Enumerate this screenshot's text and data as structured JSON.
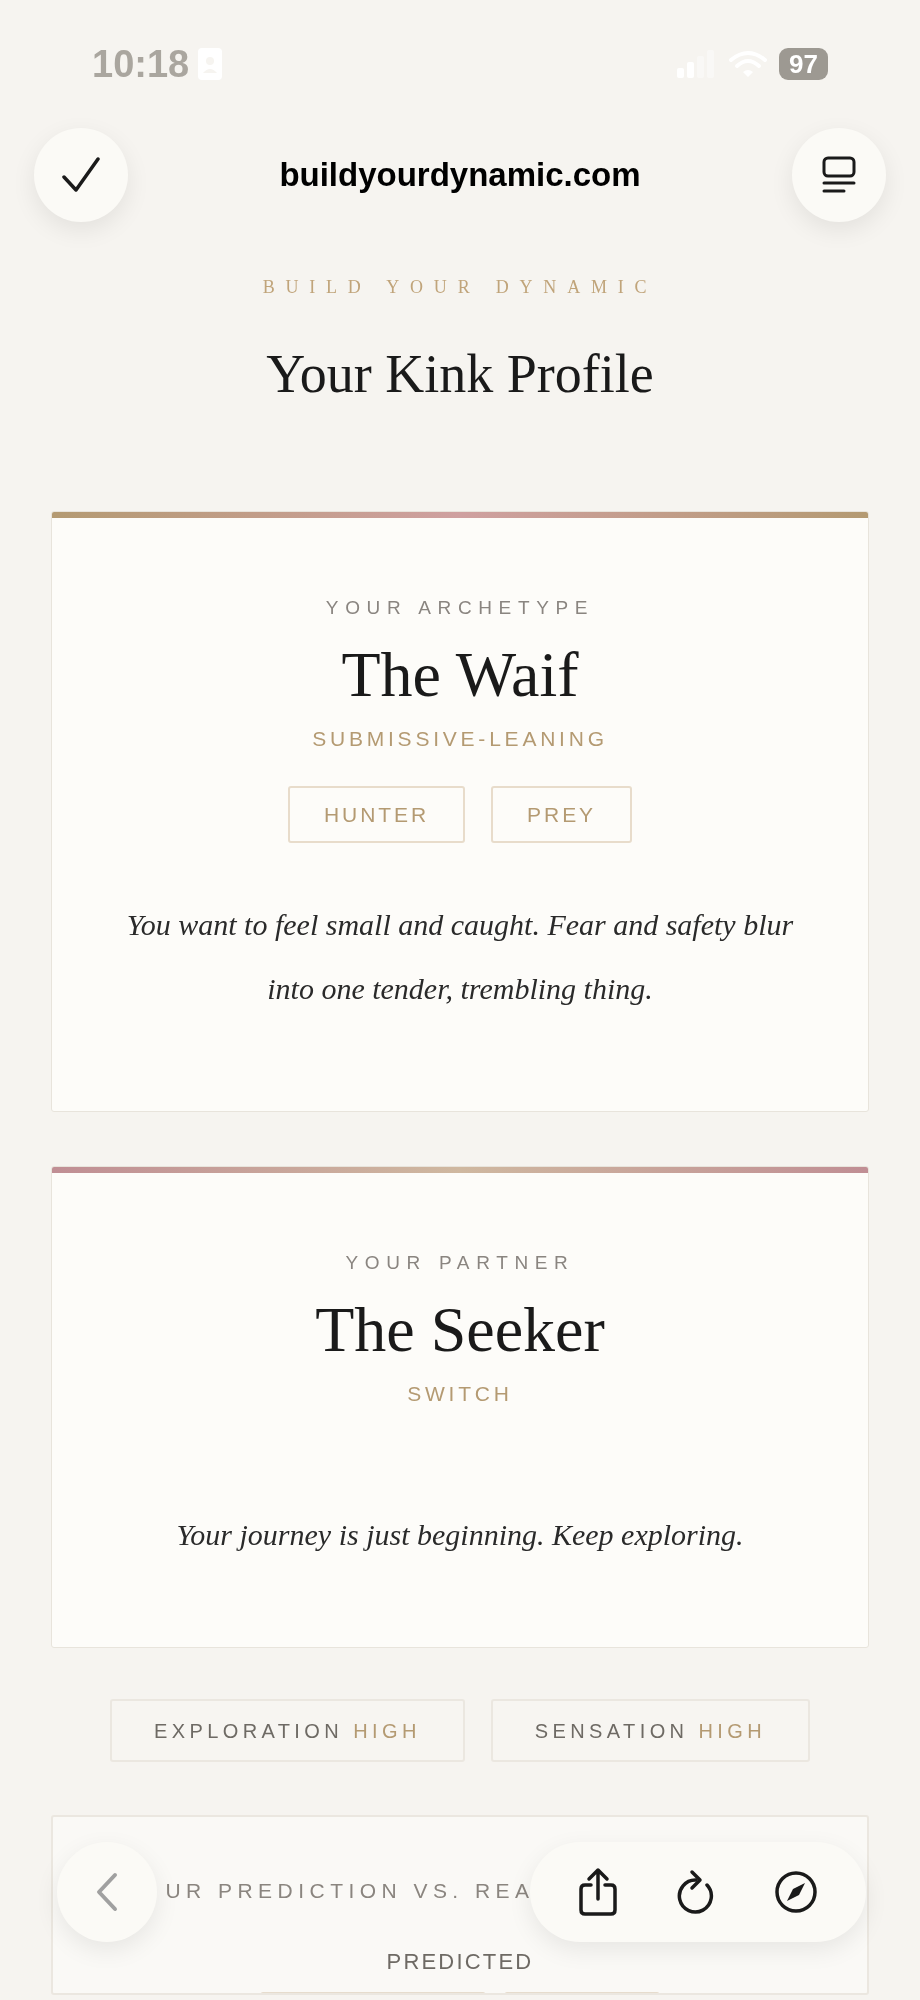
{
  "status_bar": {
    "time": "10:18",
    "battery": "97"
  },
  "browser": {
    "url": "buildyourdynamic.com"
  },
  "header": {
    "eyebrow": "BUILD YOUR DYNAMIC",
    "title": "Your Kink Profile"
  },
  "cards": [
    {
      "kind": "self",
      "label": "YOUR ARCHETYPE",
      "name": "The Waif",
      "orientation": "SUBMISSIVE-LEANING",
      "tags": [
        "HUNTER",
        "PREY"
      ],
      "description": "You want to feel small and caught. Fear and safety blur into one tender, trembling thing."
    },
    {
      "kind": "partner",
      "label": "YOUR PARTNER",
      "name": "The Seeker",
      "orientation": "SWITCH",
      "description": "Your journey is just beginning. Keep exploring."
    }
  ],
  "traits": [
    {
      "name": "EXPLORATION",
      "level_text": "HIGH"
    },
    {
      "name": "SENSATION",
      "level_text": "HIGH"
    }
  ],
  "prediction": {
    "label": "UR PREDICTION VS. REA",
    "predicted_label": "PREDICTED"
  }
}
